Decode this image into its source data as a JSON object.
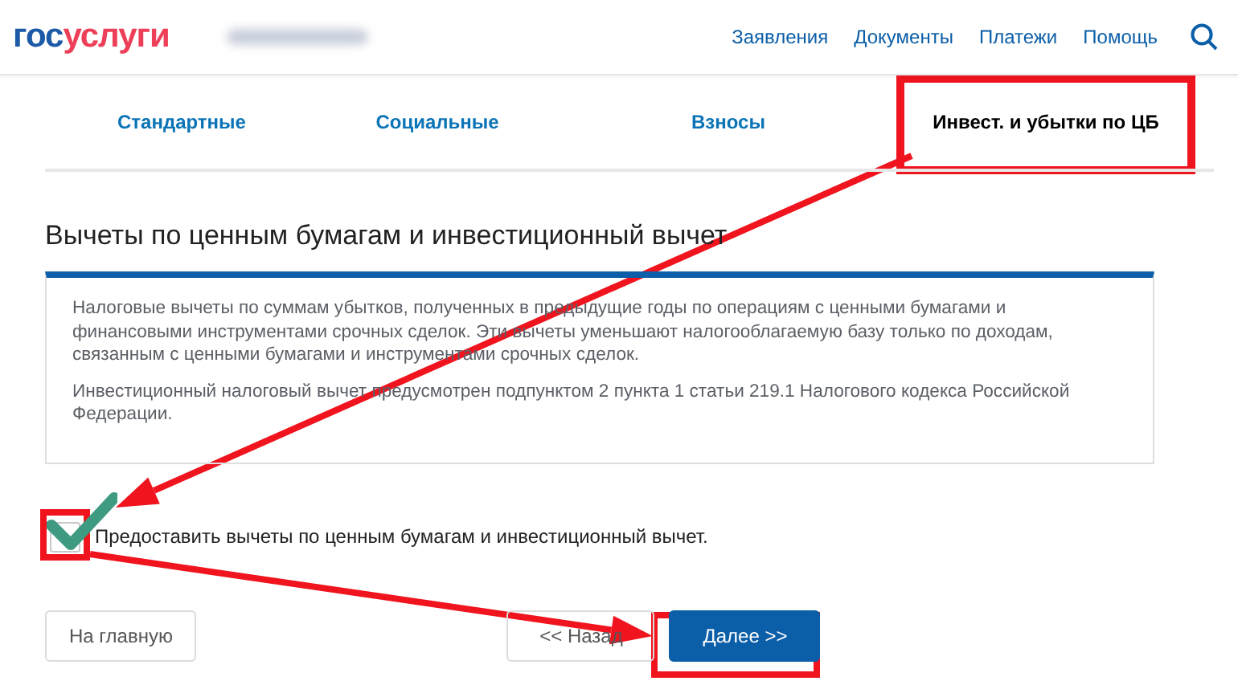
{
  "header": {
    "logo": {
      "part_1": "гос",
      "part_2": "услуги"
    },
    "nav": [
      "Заявления",
      "Документы",
      "Платежи",
      "Помощь"
    ]
  },
  "tabs": [
    {
      "label": "Стандартные",
      "selected": false
    },
    {
      "label": "Социальные",
      "selected": false
    },
    {
      "label": "Взносы",
      "selected": false
    },
    {
      "label": "Инвест. и убытки по ЦБ",
      "selected": true
    }
  ],
  "heading": "Вычеты по ценным бумагам и инвестиционный вычет",
  "info": [
    "Налоговые вычеты по суммам убытков, полученных в предыдущие годы по операциям с ценными бумагами и финансовыми инструментами срочных сделок. Эти вычеты уменьшают налогооблагаемую базу только по доходам, связанным с ценными бумагами и инструментами срочных сделок.",
    "Инвестиционный налоговый вычет предусмотрен подпунктом 2 пункта 1 статьи 219.1 Налогового кодекса Российской Федерации."
  ],
  "checkbox": {
    "label": "Предоставить вычеты по ценным бумагам и инвестиционный вычет.",
    "checked": true
  },
  "buttons": [
    {
      "label": "На главную",
      "kind": "secondary"
    },
    {
      "label": "<< Назад",
      "kind": "secondary"
    },
    {
      "label": "Далее >>",
      "kind": "primary"
    }
  ]
}
